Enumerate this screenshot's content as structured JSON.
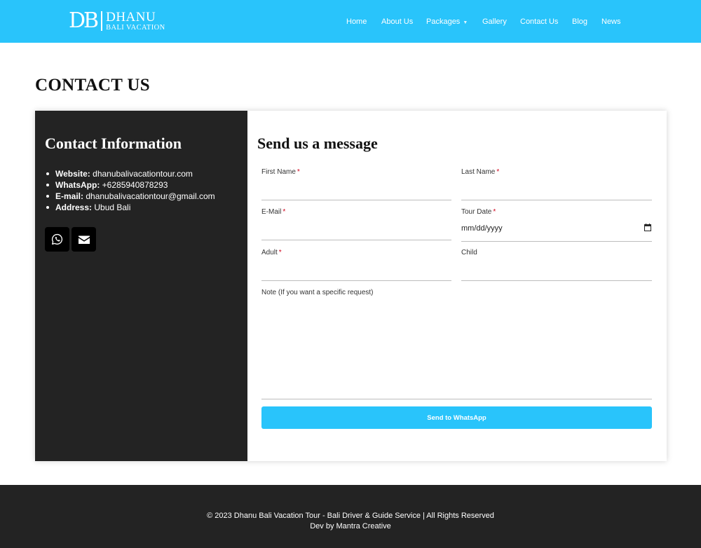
{
  "header": {
    "logo_mark": "DB",
    "logo_name": "DHANU",
    "logo_sub": "BALI VACATION",
    "nav": [
      {
        "label": "Home"
      },
      {
        "label": "About Us"
      },
      {
        "label": "Packages"
      },
      {
        "label": "Gallery"
      },
      {
        "label": "Contact Us"
      },
      {
        "label": "Blog"
      },
      {
        "label": "News"
      }
    ]
  },
  "page": {
    "title": "CONTACT US"
  },
  "contact_info": {
    "title": "Contact Information",
    "items": [
      {
        "label": "Website:",
        "value": "dhanubalivacationtour.com"
      },
      {
        "label": "WhatsApp:",
        "value": "+6285940878293"
      },
      {
        "label": "E-mail:",
        "value": "dhanubalivacationtour@gmail.com"
      },
      {
        "label": "Address:",
        "value": "Ubud Bali"
      }
    ],
    "social_icons": [
      "whatsapp-icon",
      "envelope-icon"
    ]
  },
  "form": {
    "title": "Send us a message",
    "fields": {
      "first_name": {
        "label": "First Name",
        "required_mark": "*"
      },
      "last_name": {
        "label": "Last Name",
        "required_mark": "*"
      },
      "email": {
        "label": "E-Mail",
        "required_mark": "*"
      },
      "tour_date": {
        "label": "Tour Date",
        "required_mark": "*",
        "value": "mm/dd/yyyy"
      },
      "adult": {
        "label": "Adult",
        "required_mark": "*"
      },
      "child": {
        "label": "Child"
      },
      "note": {
        "label": "Note (If you want a specific request)"
      }
    },
    "submit_label": "Send to WhatsApp"
  },
  "footer": {
    "copyright": "© 2023 Dhanu Bali Vacation Tour - Bali Driver & Guide Service | All Rights Reserved",
    "credit": "Dev by Mantra Creative"
  },
  "colors": {
    "accent": "#29c4fb",
    "dark_panel": "#232323",
    "required": "#d0021b"
  }
}
